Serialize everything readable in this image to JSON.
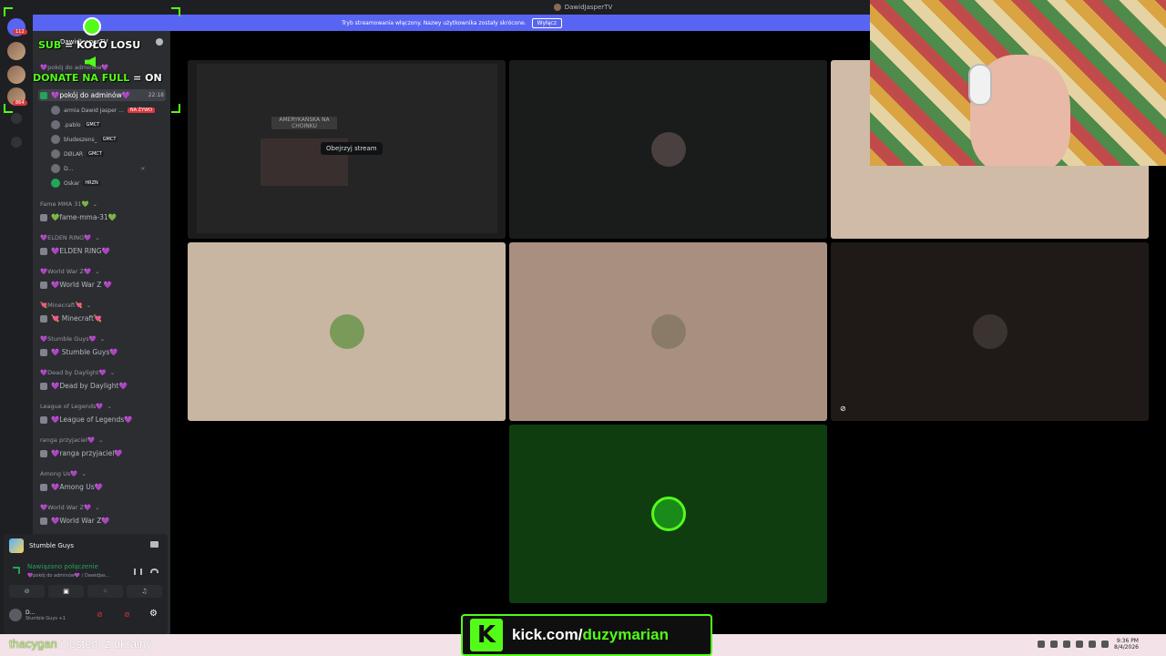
{
  "window": {
    "title": "DawidJasperTV"
  },
  "stream_banner": {
    "text": "Tryb streamowania włączony. Nazwy użytkownika zostały skrócone.",
    "button": "Wyłącz"
  },
  "server_rail": {
    "badge_top": "112",
    "badge_bottom": "864"
  },
  "overlay": {
    "line1_left": "SUB",
    "line1_right": "= KOŁO LOSU",
    "line2_left": "DONATE NA FULL",
    "line2_right": "= ON"
  },
  "sidebar": {
    "server_name": "DawidJasperTV",
    "category_top": "💜pokój do adminów💜",
    "active_channel": {
      "label": "💜pokój do adminów💜",
      "timer": "22:18"
    },
    "voice_users": [
      {
        "name": "armia Dawid Jasper ...",
        "tag": "NA ŻYWO"
      },
      {
        "name": ".pablo",
        "tag": "GMCT"
      },
      {
        "name": "bludeszens_",
        "tag": "GMCT"
      },
      {
        "name": "DØLAR",
        "tag": "GMCT"
      },
      {
        "name": "D...",
        "tag": ""
      },
      {
        "name": "Oskar",
        "tag": "HRZN"
      }
    ],
    "groups": [
      {
        "category": "Fame MMA 31💚",
        "channel": "💚fame-mma-31💚"
      },
      {
        "category": "💜ELDEN RING💜",
        "channel": "💜ELDEN RING💜"
      },
      {
        "category": "💜World War Z💜",
        "channel": "💜World War Z 💜"
      },
      {
        "category": "💘Minecraft💘",
        "channel": "💘 Minecraft💘"
      },
      {
        "category": "💜Stumble Guys💜",
        "channel": "💜 Stumble Guys💜"
      },
      {
        "category": "💜Dead by Daylight💜",
        "channel": "💜Dead by Daylight💜"
      },
      {
        "category": "League of Legends💜",
        "channel": "💜League of Legends💜"
      },
      {
        "category": "ranga przyjaciel💜",
        "channel": "💜ranga przyjaciel💜"
      },
      {
        "category": "Among Us💜",
        "channel": "💜Among Us💜"
      },
      {
        "category": "💜World War Z💜",
        "channel": "💜World War Z💜"
      }
    ]
  },
  "voice_panel": {
    "game": "Stumble Guys",
    "status": "Nawiązano połączenie",
    "channel_path": "💜pokój do adminów💜 / DawidJas...",
    "user": {
      "name": "D...",
      "activity": "Stumble Guys +1"
    }
  },
  "stream_grid": {
    "tooltip": "Obejrzyj stream",
    "screenshare_title": "AMERYKAŃSKA NA CHOINKU",
    "tile_colors": [
      "#1c1c1c",
      "#1a1c1c",
      "#d0bba7",
      "#c9b6a2",
      "#a98f80",
      "#1f1a18",
      "#0f3d0f"
    ]
  },
  "kick": {
    "prefix": "kick.com/",
    "name": "duzymarian",
    "logo": "K"
  },
  "chat": {
    "user": "thacygan",
    "message": "i jestem z ukrainy"
  },
  "clock": {
    "time": "9:36 PM",
    "date": "8/4/2026"
  },
  "colors": {
    "kick_green": "#53fc18",
    "discord_blurple": "#5865f2",
    "live_red": "#da373c"
  }
}
